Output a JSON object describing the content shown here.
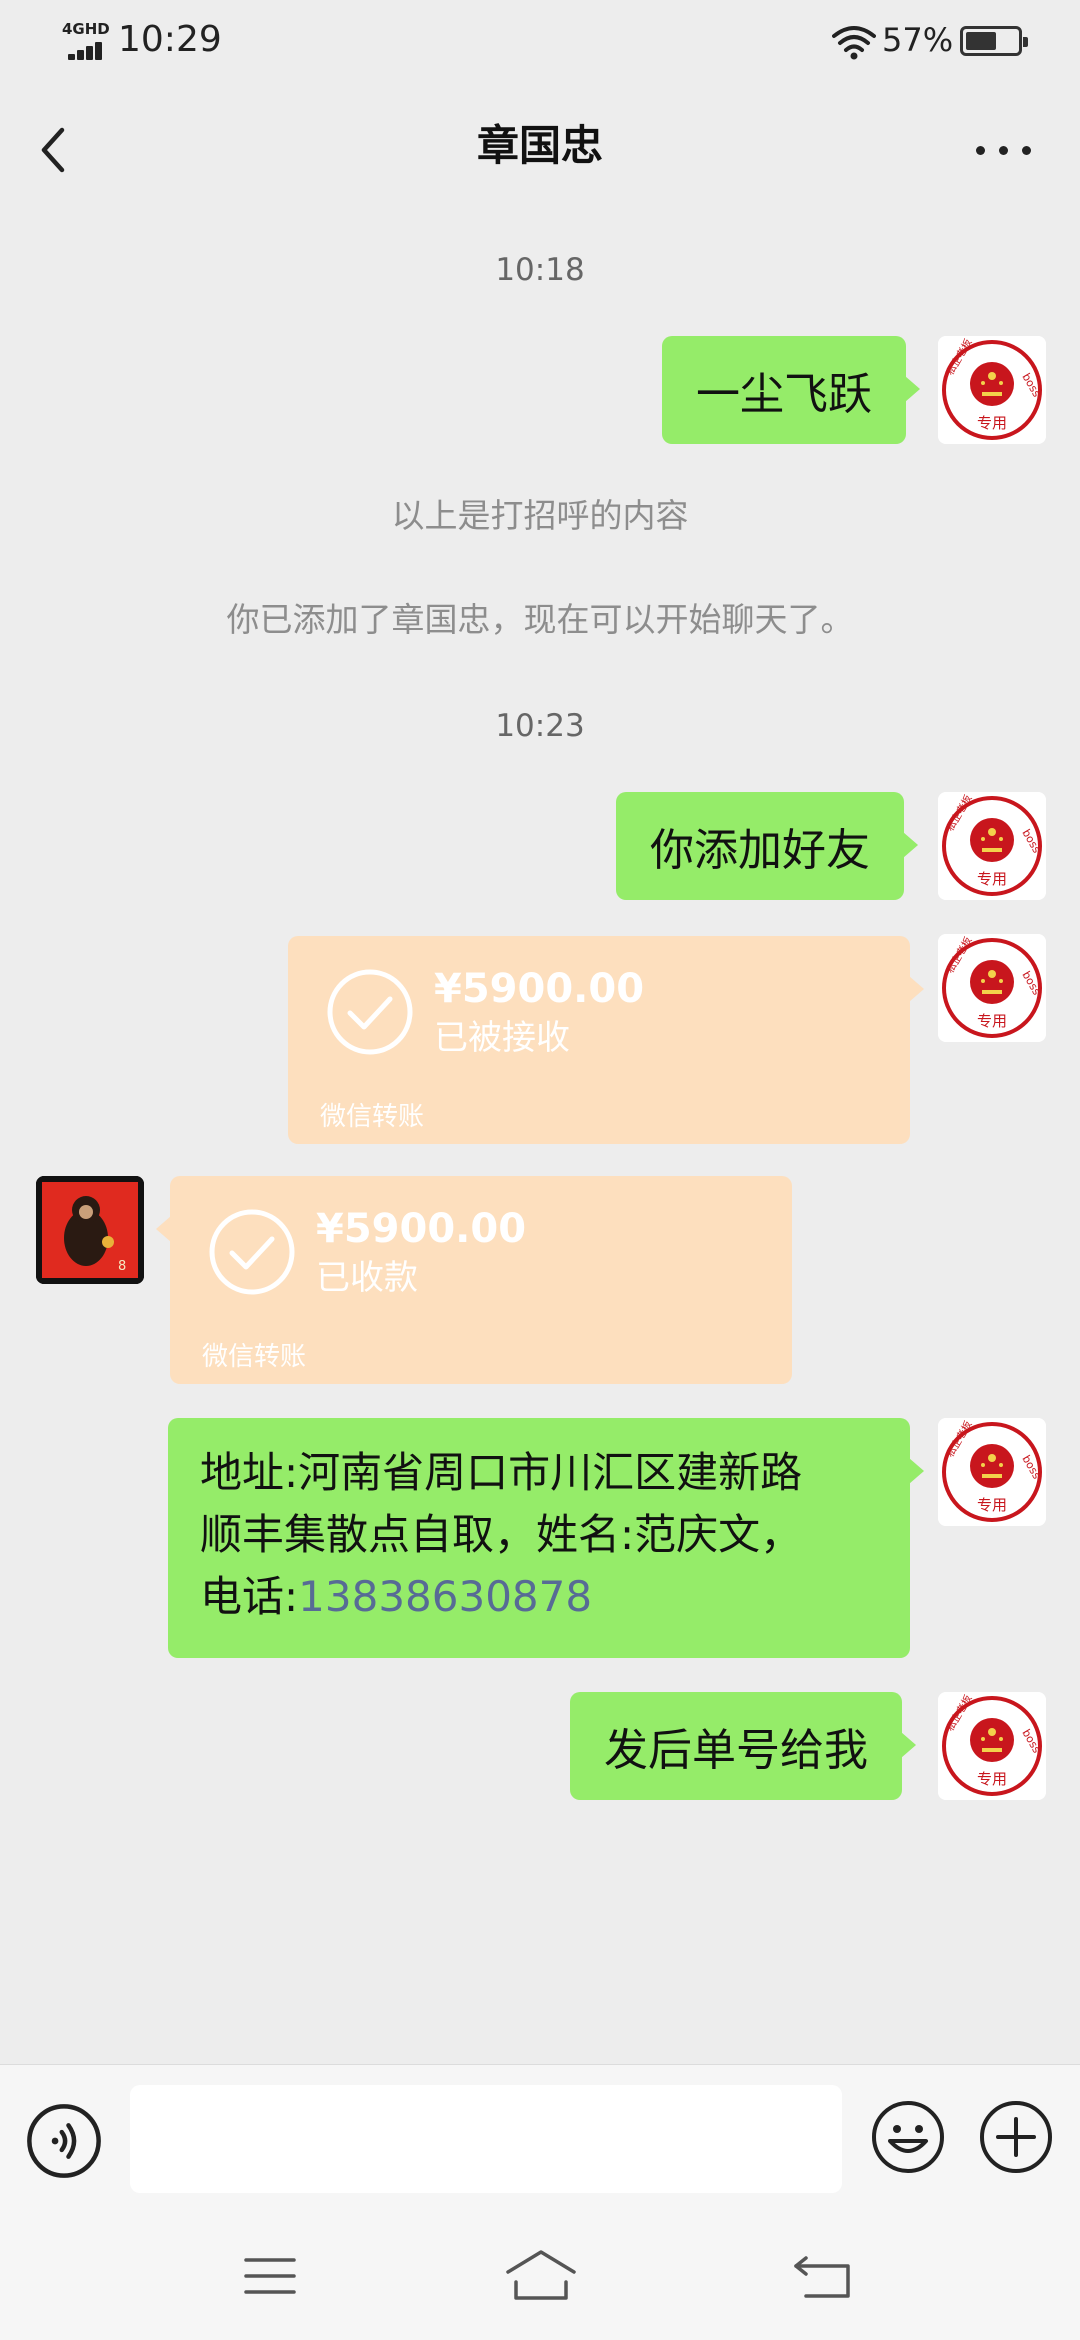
{
  "status_bar": {
    "network_label": "4GHD",
    "time": "10:29",
    "battery_percent": "57%",
    "battery_level": 0.57
  },
  "header": {
    "title": "章国忠"
  },
  "messages": {
    "time_1": "10:18",
    "msg_1": "一尘飞跃",
    "sys_1": "以上是打招呼的内容",
    "sys_2": "你已添加了章国忠，现在可以开始聊天了。",
    "time_2": "10:23",
    "msg_2": "你添加好友",
    "transfer_1": {
      "amount": "¥5900.00",
      "status": "已被接收",
      "source": "微信转账"
    },
    "transfer_2": {
      "amount": "¥5900.00",
      "status": "已收款",
      "source": "微信转账"
    },
    "address": {
      "line1": "地址:河南省周口市川汇区建新路",
      "line2": "顺丰集散点自取，姓名:范庆文，",
      "line3_prefix": "电话:",
      "phone": "13838630878"
    },
    "msg_last": "发后单号给我"
  },
  "avatar_self": {
    "stamp_text": "专用",
    "stamp_side": "boss",
    "stamp_top": "私企老板"
  },
  "avatar_other": {
    "stamp_value": "8"
  },
  "colors": {
    "bubble_green": "#95ec69",
    "transfer_orange": "#fddfbe",
    "link_blue": "#576b95",
    "stamp_red": "#c8161d"
  }
}
